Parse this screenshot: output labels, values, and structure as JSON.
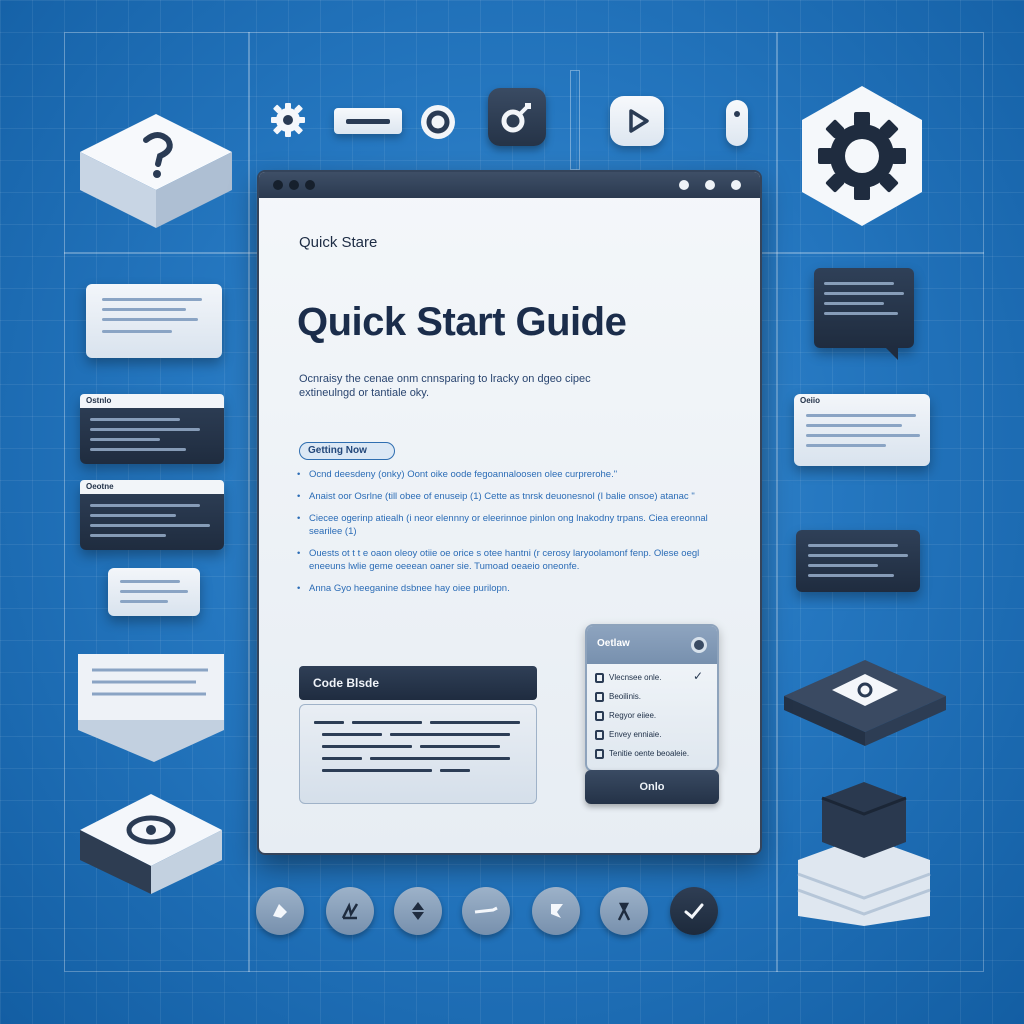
{
  "window": {
    "doc_label": "Quick Stare",
    "title": "Quick Start Guide",
    "intro": "Ocnraisy the cenae onm cnnsparing to lracky on dgeo cipec extineulngd or tantiale oky.",
    "section_pill": "Getting Now",
    "bullets": [
      "Ocnd deesdeny (onky)  Oont oike oode fegoannaloosen olee curprerohe.\"",
      "Anaist oor Osrlne (till obee of enuseip (1)  Cette as tnrsk deuonesnol (I  balie onsoe)  atanac \"",
      "Ciecee ogerinp atiealh (i neor elennny or eleerinnoe pinlon ong lnakodny trpans.  Ciea ereonnal searilee (1)",
      "Ouests ot t t e oaon oleoy otiie oe orice s otee hantni (r cerosy laryoolamonf fenp.  Olese oegl eneeuns lwlie geme oeeean oaner sie.  Tumoad oeaeio oneonfe.",
      "Anna Gyo heeganine dsbnee hay oiee purilopn."
    ],
    "code_block_label": "Code Blsde",
    "options": {
      "header": "Oetlaw",
      "items": [
        "Vlecnsee onle.",
        "Beoilinis.",
        "Regyor eiiee.",
        "Envey enniaie.",
        "Tenitie oente beoaleie."
      ],
      "button": "Onlo"
    }
  },
  "side_panels": {
    "left_card_1": "Ostnlo",
    "left_card_2": "Oeotne",
    "right_card_1": "Oeiio"
  },
  "colors": {
    "background": "#2577c0",
    "window_border": "#34445b",
    "title_text": "#1b2d4b",
    "accent_blue": "#2b6cb6"
  },
  "icons": {
    "top_bar": [
      "gear-icon",
      "minus-bar-icon",
      "ring-icon",
      "key-icon",
      "play-icon",
      "toggle-icon"
    ],
    "right_large": "settings-gear-icon",
    "left_large": "help-question-icon",
    "bottom_row": [
      "shape-icon",
      "draw-icon",
      "arrows-icon",
      "line-icon",
      "tag-icon",
      "marker-icon",
      "check-icon"
    ]
  }
}
